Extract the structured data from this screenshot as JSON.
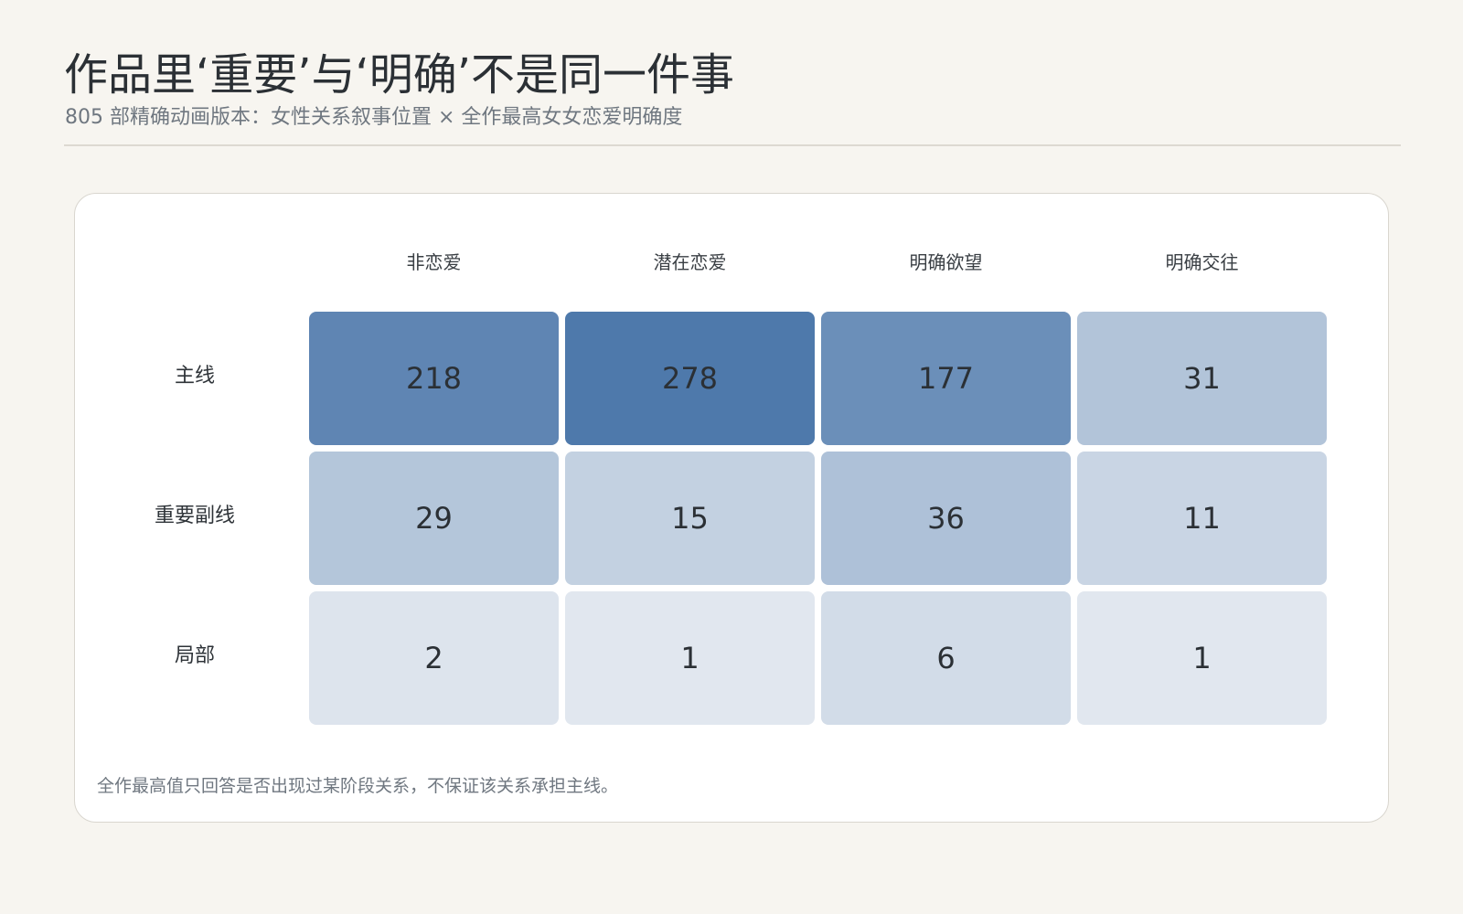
{
  "header": {
    "title": "作品里‘重要’与‘明确’不是同一件事",
    "subtitle": "805 部精确动画版本：女性关系叙事位置 × 全作最高女女恋爱明确度"
  },
  "chart_data": {
    "type": "heatmap",
    "columns": [
      "非恋爱",
      "潜在恋爱",
      "明确欲望",
      "明确交往"
    ],
    "rows": [
      "主线",
      "重要副线",
      "局部"
    ],
    "values": [
      [
        218,
        278,
        177,
        31
      ],
      [
        29,
        15,
        36,
        11
      ],
      [
        2,
        1,
        6,
        1
      ]
    ],
    "color_scale": {
      "low": "#eef1f5",
      "high": "#4e79ab",
      "min": 0,
      "max": 278
    },
    "note": "全作最高值只回答是否出现过某阶段关系，不保证该关系承担主线。"
  }
}
